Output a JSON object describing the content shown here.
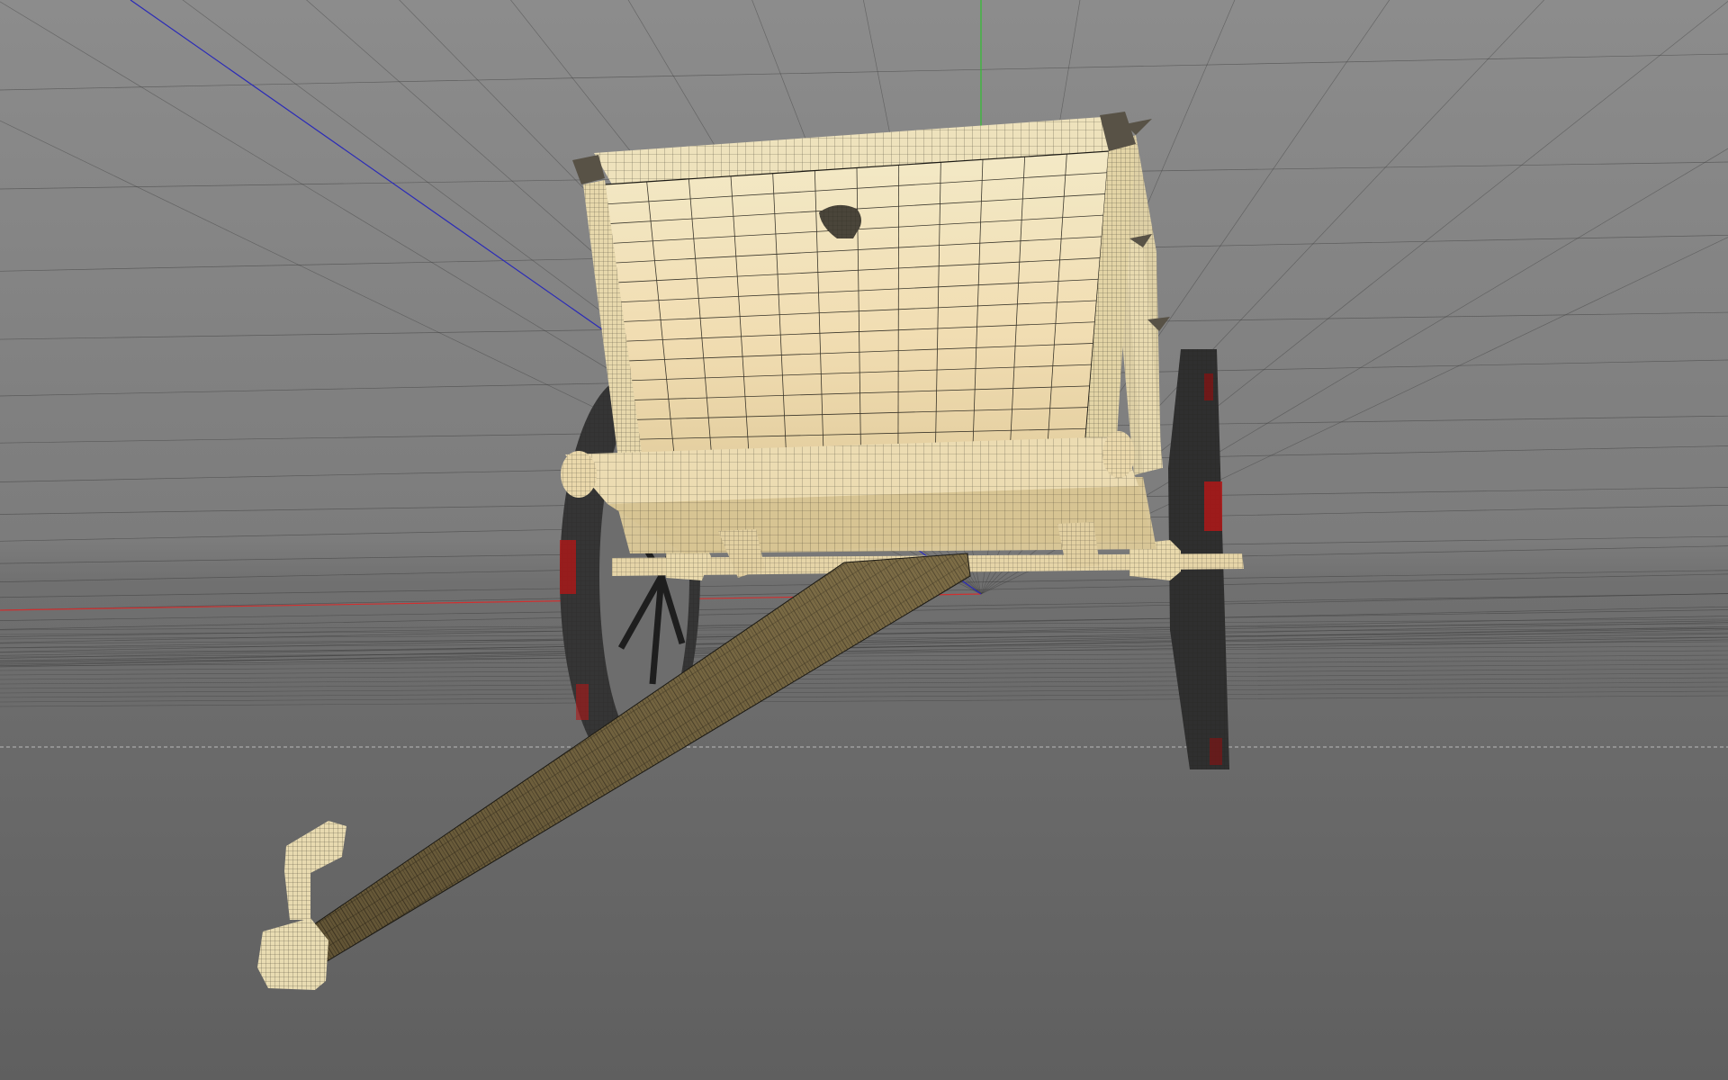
{
  "viewport": {
    "background_top": "#8b8b8b",
    "background_horizon": "#7a7a7a",
    "background_bottom": "#5e5e5e",
    "grid_color": "#3a3a3a",
    "axis_x_color": "#d02020",
    "axis_y_color": "#20c020",
    "axis_z_color": "#2020c0"
  },
  "model": {
    "wood_light": "#efe2b8",
    "wood_mid": "#d9c697",
    "wood_dark": "#7a6a44",
    "wire_color": "#1c1a14",
    "wheel_rim": "#3a3a3a",
    "wheel_accent": "#b01818"
  },
  "icons": [
    "world-axis-icon"
  ]
}
